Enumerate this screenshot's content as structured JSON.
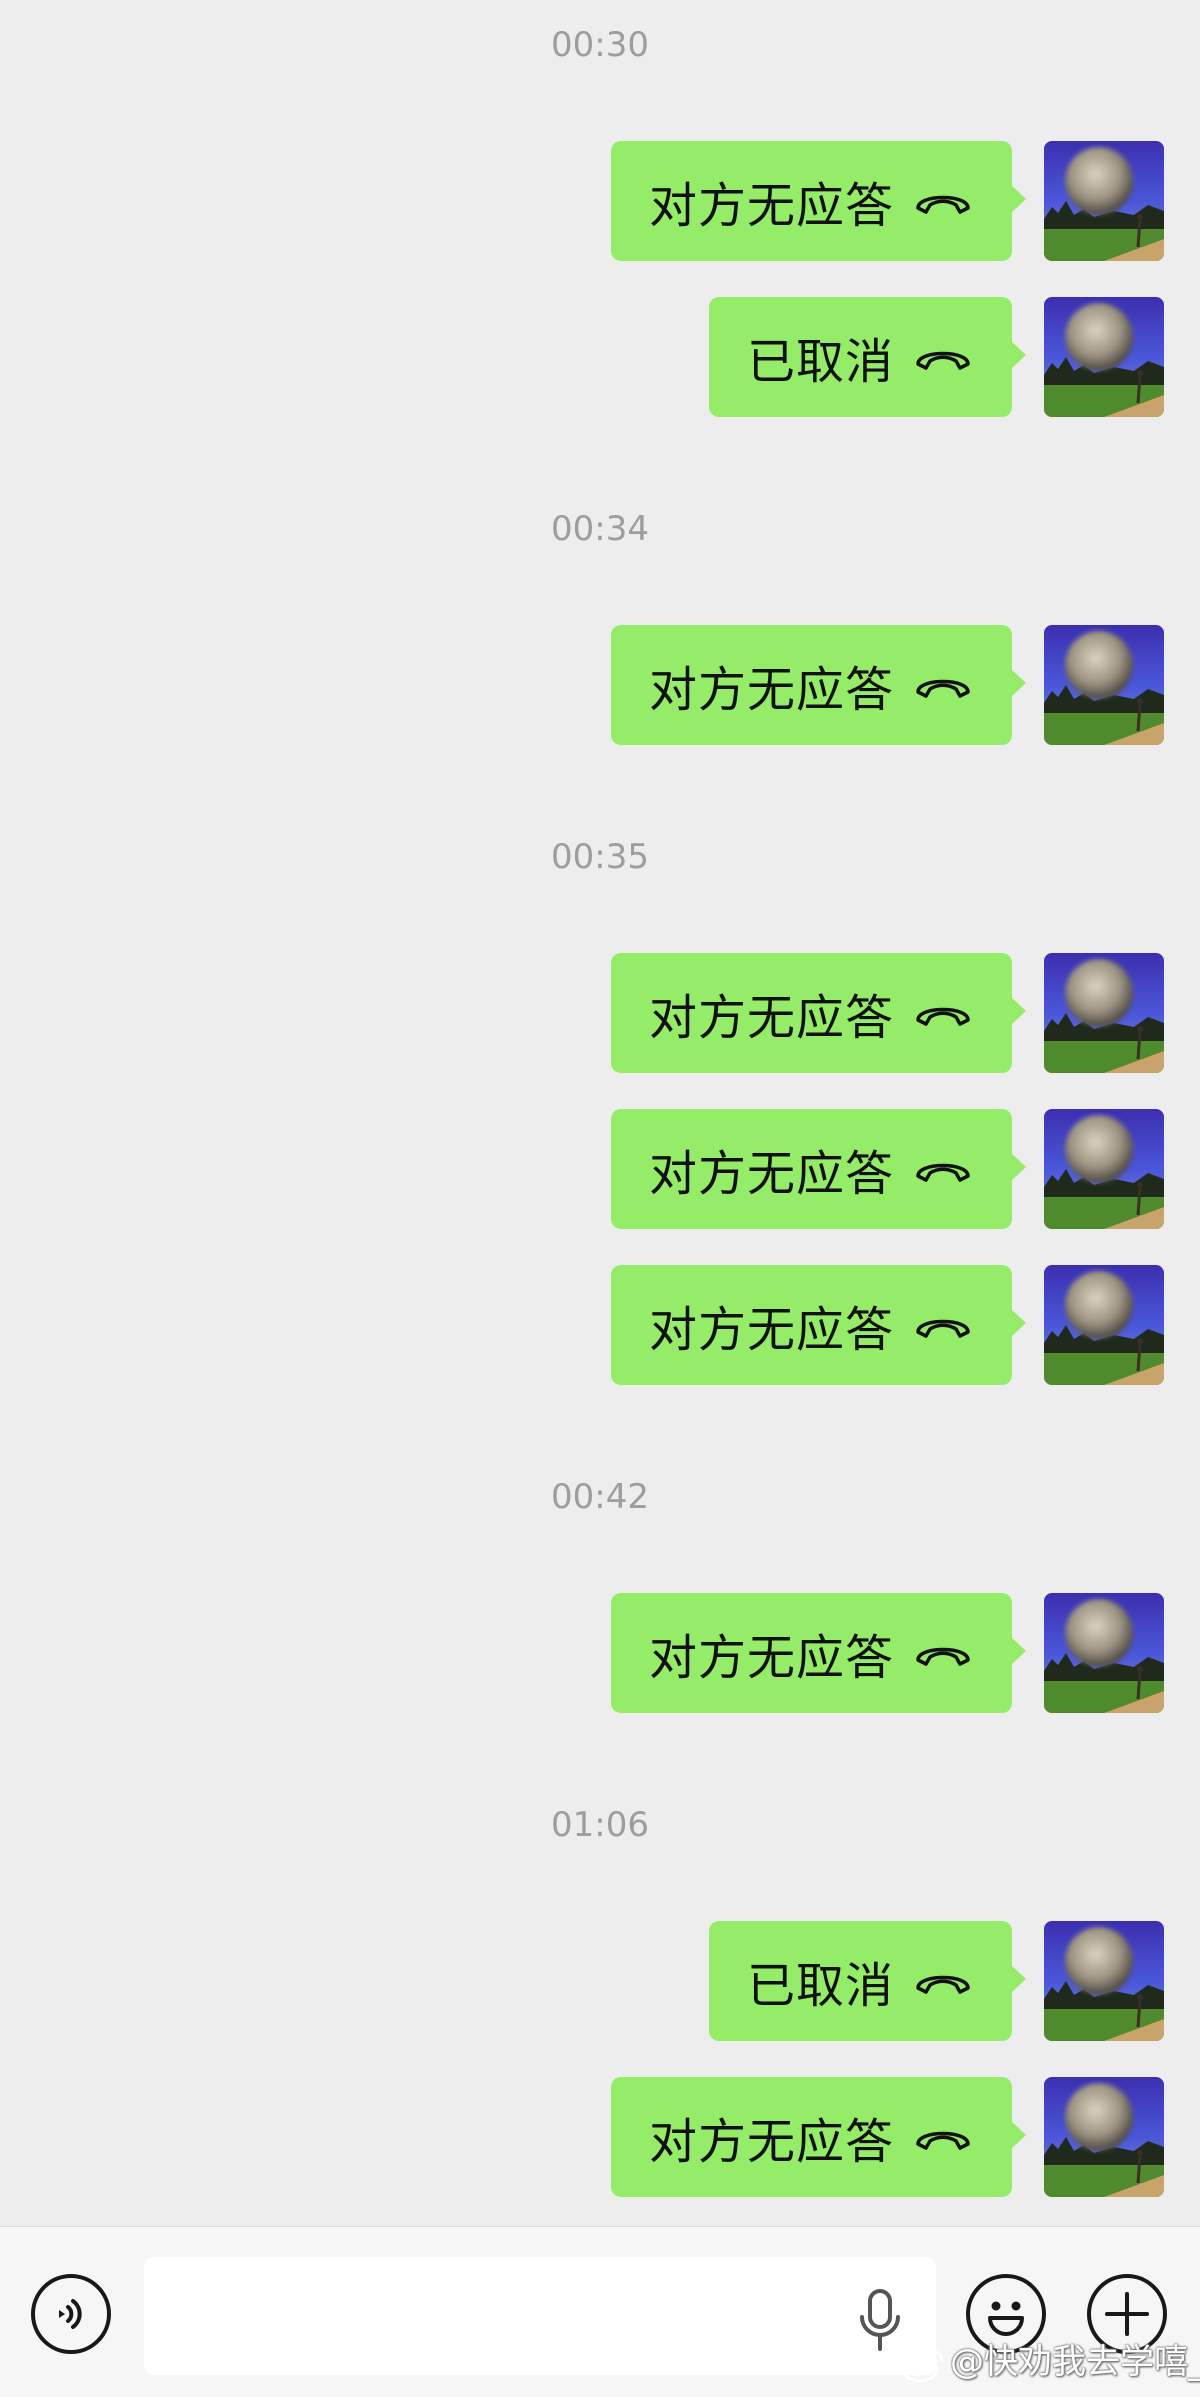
{
  "chat": {
    "groups": [
      {
        "time": "00:30",
        "messages": [
          {
            "text": "对方无应答",
            "icon": "hangup-phone-icon"
          },
          {
            "text": "已取消",
            "icon": "hangup-phone-icon"
          }
        ]
      },
      {
        "time": "00:34",
        "messages": [
          {
            "text": "对方无应答",
            "icon": "hangup-phone-icon"
          }
        ]
      },
      {
        "time": "00:35",
        "messages": [
          {
            "text": "对方无应答",
            "icon": "hangup-phone-icon"
          },
          {
            "text": "对方无应答",
            "icon": "hangup-phone-icon"
          },
          {
            "text": "对方无应答",
            "icon": "hangup-phone-icon"
          }
        ]
      },
      {
        "time": "00:42",
        "messages": [
          {
            "text": "对方无应答",
            "icon": "hangup-phone-icon"
          }
        ]
      },
      {
        "time": "01:06",
        "messages": [
          {
            "text": "已取消",
            "icon": "hangup-phone-icon"
          },
          {
            "text": "对方无应答",
            "icon": "hangup-phone-icon"
          }
        ]
      }
    ]
  },
  "input_bar": {
    "text_value": "",
    "icons": [
      "voice-toggle-icon",
      "microphone-icon",
      "emoji-icon",
      "add-plus-icon"
    ]
  },
  "watermark": {
    "text": "@快劝我去学嘻_",
    "icon": "weibo-logo-icon"
  },
  "colors": {
    "background": "#ededed",
    "bubble": "#95ec69",
    "timestamp": "#9d9d9d",
    "input_bar": "#f6f6f6"
  }
}
